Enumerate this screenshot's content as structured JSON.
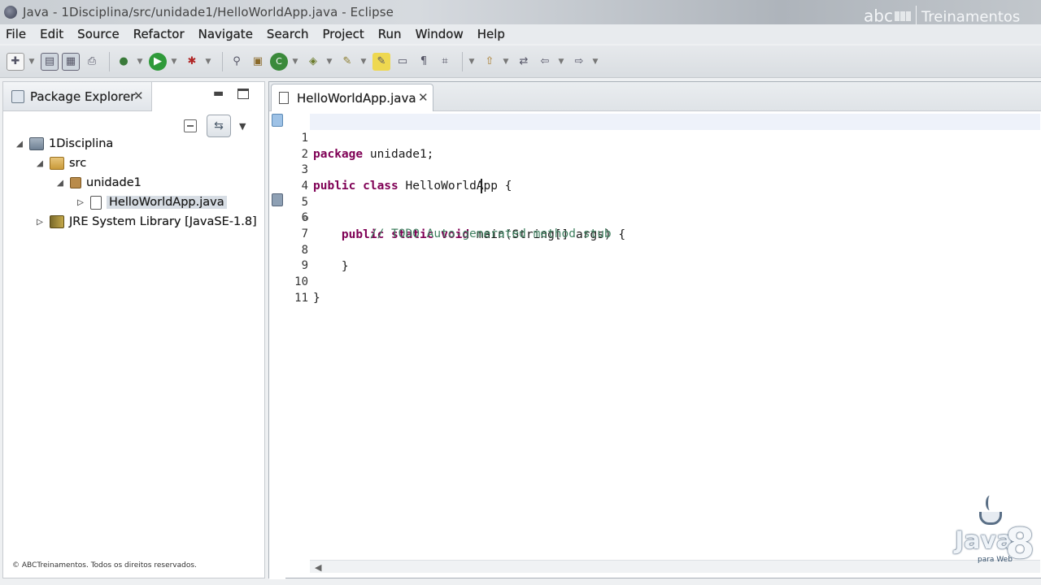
{
  "window": {
    "title": "Java - 1Disciplina/src/unidade1/HelloWorldApp.java - Eclipse",
    "app_icon": "eclipse-icon"
  },
  "watermark": {
    "brand_prefix": "abc",
    "brand_name": "Treinamentos",
    "copyright": "© ABCTreinamentos. Todos os direitos reservados.",
    "java_word": "Java",
    "java_version": "8",
    "java_sub": "para Web"
  },
  "menu": [
    "File",
    "Edit",
    "Source",
    "Refactor",
    "Navigate",
    "Search",
    "Project",
    "Run",
    "Window",
    "Help"
  ],
  "toolbar_icons": [
    "new-icon",
    "save-icon",
    "save-all-icon",
    "print-icon",
    "skip-breakpoints-icon",
    "run-icon",
    "debug-icon",
    "search-icon",
    "new-java-project-icon",
    "new-class-icon",
    "open-type-icon",
    "open-task-icon",
    "next-annotation-icon",
    "prev-annotation-icon",
    "back-icon",
    "forward-icon"
  ],
  "package_explorer": {
    "title": "Package Explorer",
    "tree": [
      {
        "label": "1Disciplina",
        "icon": "project-icon",
        "level": 0,
        "expanded": true
      },
      {
        "label": "src",
        "icon": "source-folder-icon",
        "level": 1,
        "expanded": true
      },
      {
        "label": "unidade1",
        "icon": "package-icon",
        "level": 2,
        "expanded": true
      },
      {
        "label": "HelloWorldApp.java",
        "icon": "java-file-icon",
        "level": 3,
        "expanded": false,
        "selected": true
      },
      {
        "label": "JRE System Library [JavaSE-1.8]",
        "icon": "library-icon",
        "level": 1,
        "expanded": false
      }
    ]
  },
  "editor": {
    "tab_label": "HelloWorldApp.java",
    "lines": [
      "1",
      "2",
      "3",
      "4",
      "5",
      "6",
      "7",
      "8",
      "9",
      "10",
      "11"
    ],
    "code": {
      "l1_kw": "package",
      "l1_rest": " unidade1;",
      "l3_kw": "public class",
      "l3_rest": " HelloWorldApp {",
      "l5_indent": "    ",
      "l5_kw": "public static void",
      "l5_rest": " main(String[] args) {",
      "l6_comment": "        // TODO Auto-generated method stub",
      "l8": "    }",
      "l10": "}"
    },
    "fold_symbol": "⊖"
  }
}
